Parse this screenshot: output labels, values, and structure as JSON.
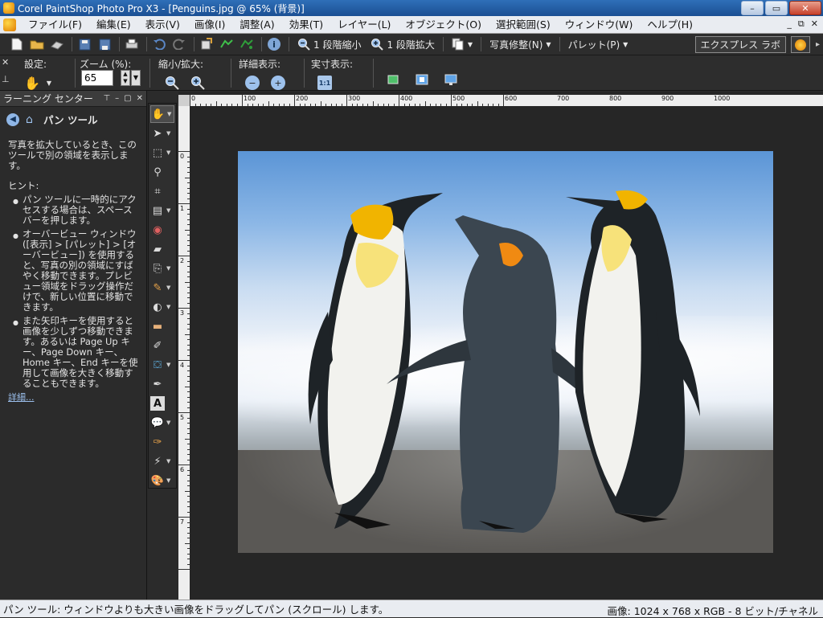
{
  "window": {
    "title": "Corel PaintShop Photo Pro X3 - [Penguins.jpg @  65% (背景)]",
    "controls": [
      "–",
      "▭",
      "✕"
    ]
  },
  "menu": {
    "items": [
      "ファイル(F)",
      "編集(E)",
      "表示(V)",
      "画像(I)",
      "調整(A)",
      "効果(T)",
      "レイヤー(L)",
      "オブジェクト(O)",
      "選択範囲(S)",
      "ウィンドウ(W)",
      "ヘルプ(H)"
    ],
    "mdi_controls": [
      "_",
      "⧉",
      "✕"
    ]
  },
  "toolbar": {
    "zoom_out_label": "1 段階縮小",
    "zoom_in_label": "1 段階拡大",
    "photo_fix_label": "写真修整(N)",
    "palette_label": "パレット(P)",
    "express_lab_label": "エクスプレス ラボ",
    "info_icon_text": "i"
  },
  "tool_options": {
    "settings_label": "設定:",
    "zoom_label": "ズーム (%):",
    "zoom_value": "65",
    "zoom_inout_label": "縮小/拡大:",
    "detail_label": "詳細表示:",
    "actual_size_label": "実寸表示:",
    "actual_size_icon_text": "1:1"
  },
  "learning_center": {
    "header": "ラーニング センター",
    "header_controls": [
      "⊤",
      "–",
      "▢",
      "✕"
    ],
    "tool_title": "パン ツール",
    "intro": "写真を拡大しているとき、このツールで別の領域を表示します。",
    "hint_label": "ヒント:",
    "hints": [
      "パン ツールに一時的にアクセスする場合は、スペースバーを押します。",
      "オーバービュー ウィンドウ ([表示] > [パレット] > [オーバービュー]) を使用すると、写真の別の領域にすばやく移動できます。プレビュー領域をドラッグ操作だけで、新しい位置に移動できます。",
      "また矢印キーを使用すると画像を少しずつ移動できます。あるいは Page Up キー、Page Down キー、Home キー、End キーを使用して画像を大きく移動することもできます。"
    ],
    "more_link": "詳細..."
  },
  "ruler": {
    "top_labels": [
      "0",
      "100",
      "200",
      "300",
      "400",
      "500",
      "600",
      "700",
      "800",
      "900",
      "1000"
    ],
    "left_labels": [
      "0",
      "1",
      "2",
      "3",
      "4",
      "5",
      "6",
      "7"
    ]
  },
  "document": {
    "image_description": "Three king penguins standing on a beach"
  },
  "status": {
    "left": "パン ツール: ウィンドウよりも大きい画像をドラッグしてパン (スクロール) します。",
    "right": "画像:  1024 x 768 x RGB - 8 ビット/チャネル"
  },
  "colors": {
    "titlebar": "#1b4f93",
    "workspace": "#2b2b2b",
    "menubar": "#e9ecf1",
    "accent_icon": "#8fb6e6"
  }
}
